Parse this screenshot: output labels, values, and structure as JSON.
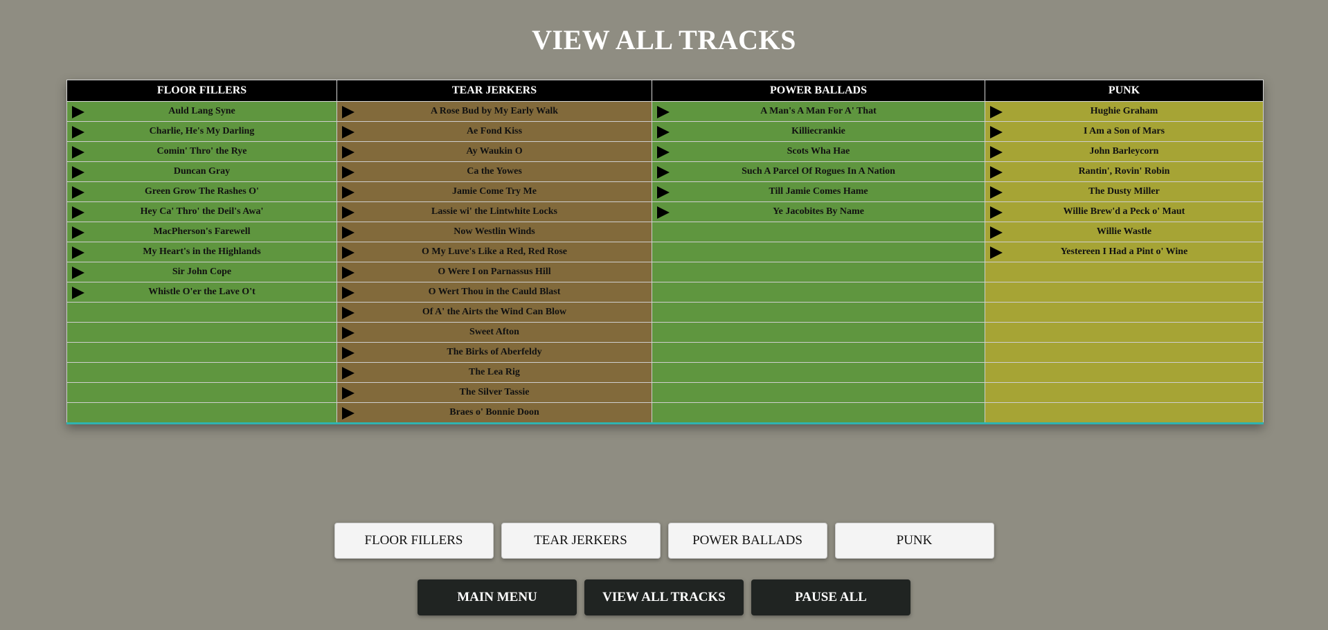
{
  "page_title": "VIEW ALL TRACKS",
  "colors": {
    "background": "#8f8d82",
    "header_bg": "#000000",
    "floor_fillers": "#5f963f",
    "tear_jerkers": "#826a3b",
    "power_ballads": "#5f963f",
    "punk": "#a6a435",
    "bottom_border": "#2fb3b0"
  },
  "columns": [
    {
      "header": "FLOOR FILLERS",
      "tracks": [
        "Auld Lang Syne",
        "Charlie, He's My Darling",
        "Comin' Thro' the Rye",
        "Duncan Gray",
        "Green Grow The Rashes O'",
        "Hey Ca' Thro' the Deil's Awa'",
        "MacPherson's Farewell",
        "My Heart's in the Highlands",
        "Sir John Cope",
        "Whistle O'er the Lave O't"
      ]
    },
    {
      "header": "TEAR JERKERS",
      "tracks": [
        "A Rose Bud by My Early Walk",
        "Ae Fond Kiss",
        "Ay Waukin O",
        "Ca the Yowes",
        "Jamie Come Try Me",
        "Lassie wi' the Lintwhite Locks",
        "Now Westlin Winds",
        "O My Luve's Like a Red, Red Rose",
        "O Were I on Parnassus Hill",
        "O Wert Thou in the Cauld Blast",
        "Of A' the Airts the Wind Can Blow",
        "Sweet Afton",
        "The Birks of Aberfeldy",
        "The Lea Rig",
        "The Silver Tassie",
        "Braes o' Bonnie Doon"
      ]
    },
    {
      "header": "POWER BALLADS",
      "tracks": [
        "A Man's A Man For A' That",
        "Killiecrankie",
        "Scots Wha Hae",
        "Such A Parcel Of Rogues In A Nation",
        "Till Jamie Comes Hame",
        "Ye Jacobites By Name"
      ]
    },
    {
      "header": "PUNK",
      "tracks": [
        "Hughie Graham",
        "I Am a Son of Mars",
        "John Barleycorn",
        "Rantin', Rovin' Robin",
        "The Dusty Miller",
        "Willie Brew'd a Peck o' Maut",
        "Willie Wastle",
        "Yestereen I Had a Pint o' Wine"
      ]
    }
  ],
  "category_buttons": [
    "FLOOR FILLERS",
    "TEAR JERKERS",
    "POWER BALLADS",
    "PUNK"
  ],
  "nav_buttons": [
    "MAIN MENU",
    "VIEW ALL TRACKS",
    "PAUSE ALL"
  ]
}
